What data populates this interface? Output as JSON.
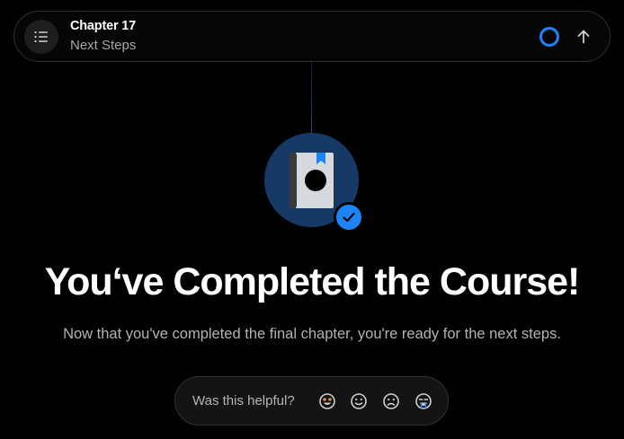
{
  "header": {
    "chapter": "Chapter 17",
    "subtitle": "Next Steps",
    "menu_icon": "list-icon",
    "progress_icon": "progress-ring-icon",
    "up_icon": "arrow-up-icon"
  },
  "hero": {
    "badge_icon": "book-bookmark-icon",
    "check_icon": "checkmark-icon",
    "title": "You‘ve Completed the Course!",
    "subtitle": "Now that you've completed the final chapter, you're ready for the next steps."
  },
  "feedback": {
    "label": "Was this helpful?",
    "options": [
      "star-struck-emoji",
      "smile-emoji",
      "frown-emoji",
      "crying-emoji"
    ]
  },
  "colors": {
    "accent": "#1c84f5",
    "badge_bg": "#163965",
    "background": "#000000"
  }
}
